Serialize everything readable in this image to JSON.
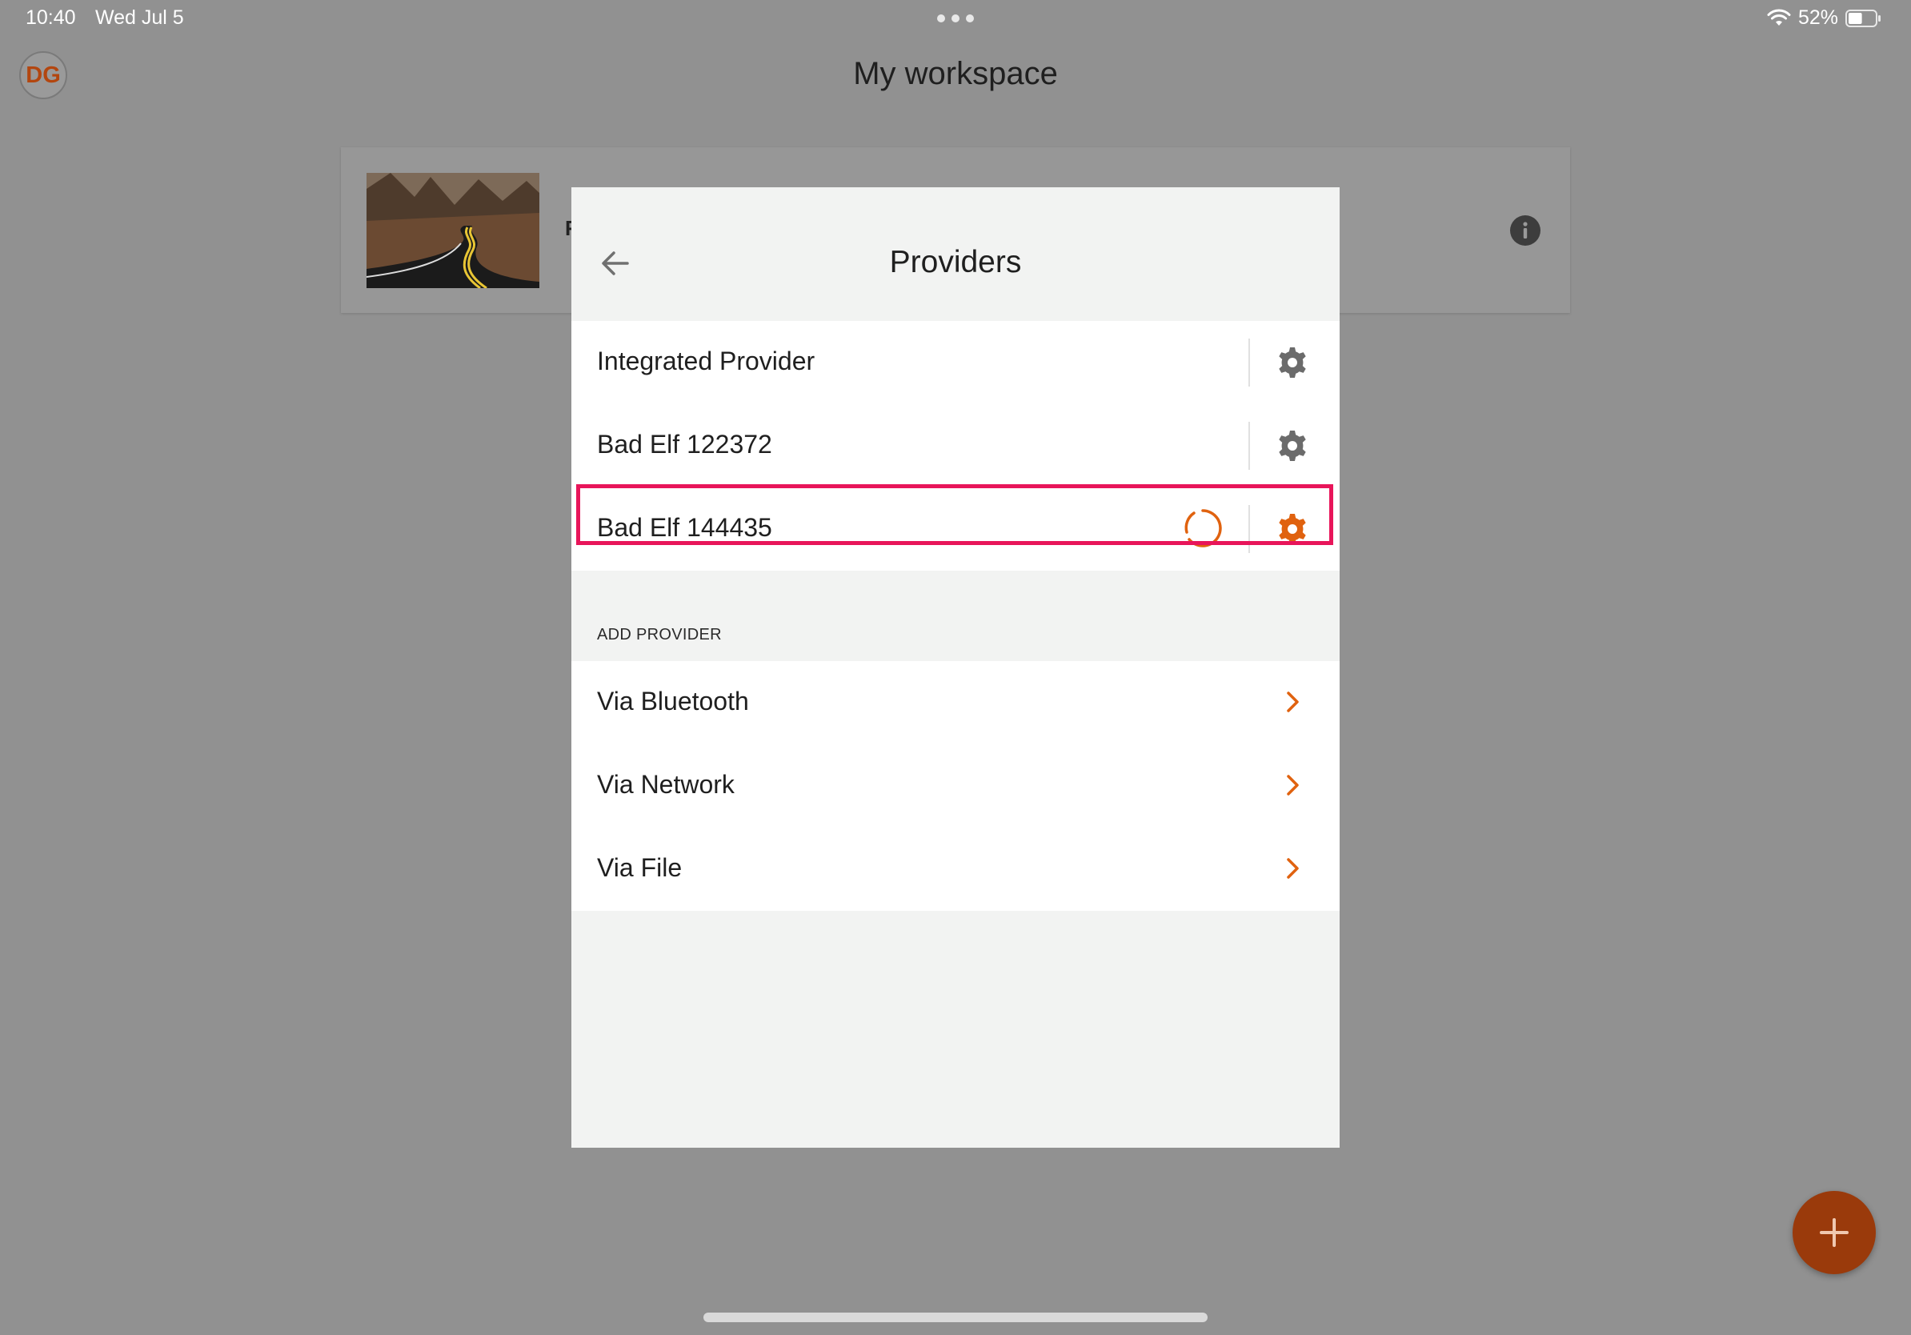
{
  "status_bar": {
    "time": "10:40",
    "date": "Wed Jul 5",
    "battery_percent": "52%",
    "battery_level": 0.52
  },
  "header": {
    "avatar_initials": "DG",
    "title": "My workspace"
  },
  "workspace_card": {
    "name_visible": "F"
  },
  "modal": {
    "title": "Providers",
    "providers": [
      {
        "label": "Integrated Provider",
        "gear_color": "#6b6b6b",
        "connecting": false
      },
      {
        "label": "Bad Elf 122372",
        "gear_color": "#6b6b6b",
        "connecting": false
      },
      {
        "label": "Bad Elf 144435",
        "gear_color": "#e0620f",
        "connecting": true
      }
    ],
    "add_section_label": "ADD PROVIDER",
    "add_options": [
      {
        "label": "Via Bluetooth"
      },
      {
        "label": "Via Network"
      },
      {
        "label": "Via File"
      }
    ]
  },
  "colors": {
    "accent": "#e0620f",
    "fab": "#9a3a0b",
    "highlight": "#e8155a"
  },
  "icons": {
    "back": "arrow-left-icon",
    "gear": "gear-icon",
    "chevron": "chevron-right-icon",
    "info": "info-icon",
    "fab": "plus-icon",
    "spinner": "loading-spinner-icon"
  }
}
